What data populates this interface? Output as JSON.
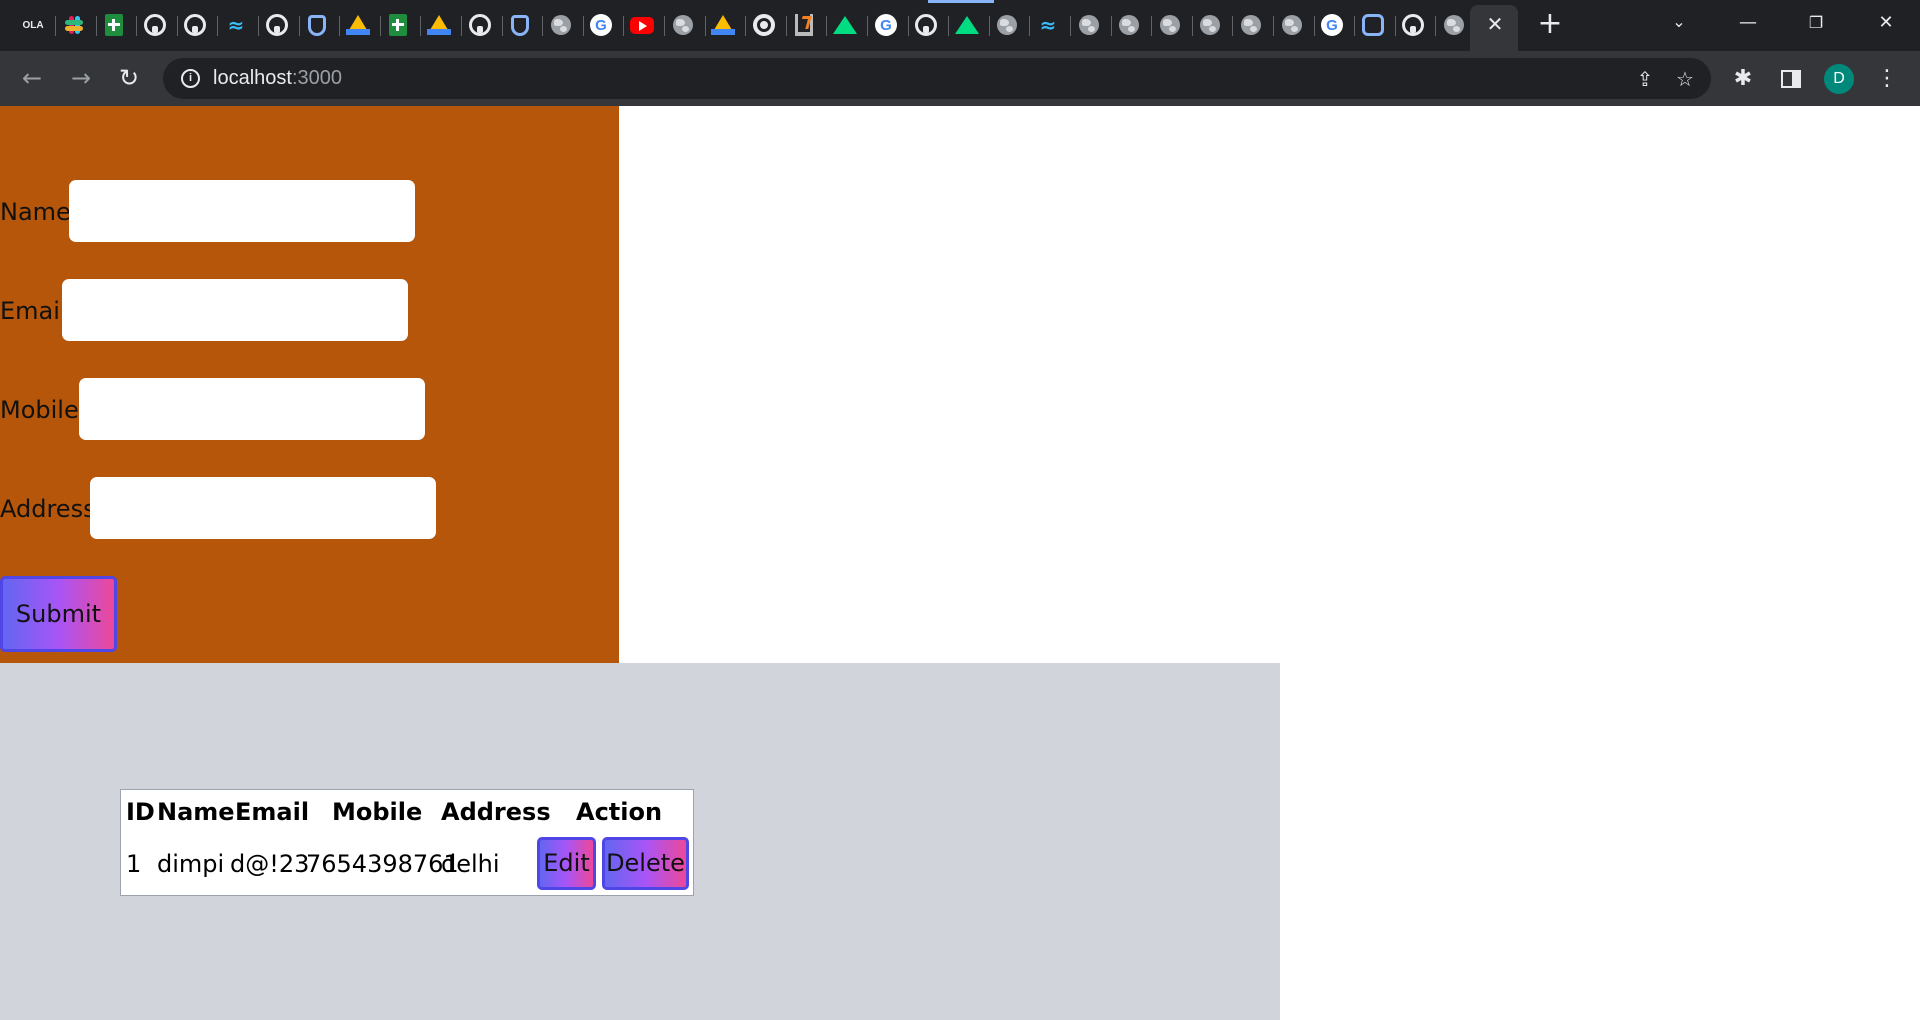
{
  "browser": {
    "url_host": "localhost",
    "url_port": ":3000",
    "profile_initial": "D",
    "tab_close_glyph": "✕",
    "new_tab_glyph": "+",
    "favicons": [
      "ola-icon",
      "slack-icon",
      "sheets-icon",
      "github-icon",
      "github-icon",
      "tailwind-icon",
      "github-icon",
      "shield-icon",
      "drive-icon",
      "sheets-icon",
      "drive-icon",
      "github-icon",
      "shield-icon",
      "globe-icon",
      "google-icon",
      "youtube-icon",
      "globe-icon",
      "drive-icon",
      "chrome-icon",
      "stackoverflow-icon",
      "nuxt-icon",
      "google-icon",
      "github-icon",
      "nuxt-icon",
      "globe-icon",
      "tailwind-icon",
      "globe-icon",
      "globe-icon",
      "globe-icon",
      "globe-icon",
      "globe-icon",
      "globe-icon",
      "google-icon",
      "link-icon",
      "github-icon",
      "globe-icon"
    ]
  },
  "form": {
    "name_label": "Name:",
    "email_label": "Email:",
    "mobile_label": "Mobile:",
    "address_label": "Address:",
    "name_value": "",
    "email_value": "",
    "mobile_value": "",
    "address_value": "",
    "submit_label": "Submit"
  },
  "table": {
    "headers": [
      "ID",
      "Name",
      "Email",
      "Mobile",
      "Address",
      "Action"
    ],
    "rows": [
      {
        "id": "1",
        "name": "dimpi",
        "email": "d@!23",
        "mobile": "7654398761",
        "address": "delhi",
        "edit_label": "Edit",
        "delete_label": "Delete"
      }
    ]
  },
  "colors": {
    "form_bg": "#b6560a",
    "table_area_bg": "#d1d5db",
    "button_gradient": [
      "#6366f1",
      "#a855f7",
      "#ec4899"
    ],
    "button_border": "#4f46e5"
  }
}
